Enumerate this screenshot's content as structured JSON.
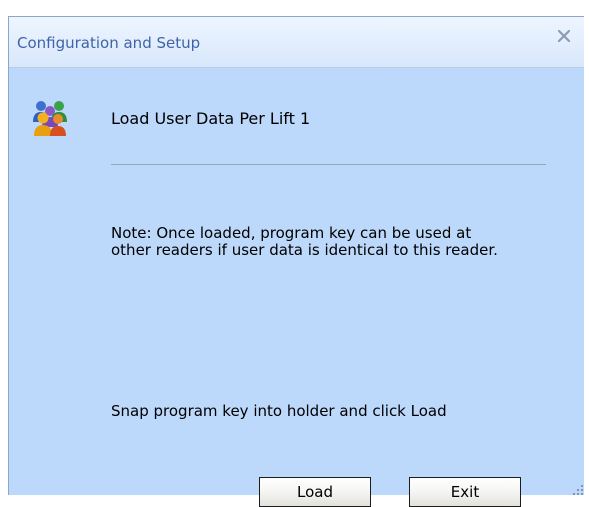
{
  "window": {
    "title": "Configuration and Setup",
    "close_icon": "close-icon"
  },
  "content": {
    "icon": "users-icon",
    "heading": "Load User Data Per Lift 1",
    "note_lines": [
      "Note: Once loaded, program key can be used at",
      "other readers if user data is identical to this reader."
    ],
    "instruction": "Snap program key into holder and click Load"
  },
  "buttons": {
    "load_label": "Load",
    "exit_label": "Exit"
  },
  "colors": {
    "dialog_background": "#bcd8fa",
    "title_text": "#3f63a8"
  }
}
